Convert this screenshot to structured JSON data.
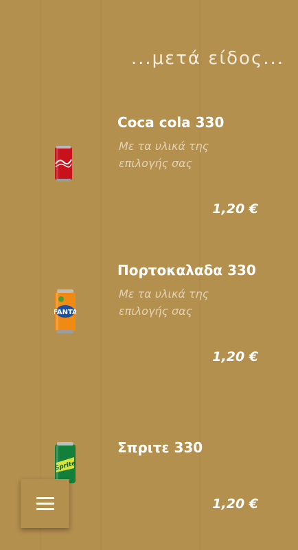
{
  "page": {
    "title": "...μετά είδος..."
  },
  "items": [
    {
      "name": "Coca cola 330",
      "description": "Με τα υλικά της επιλογής σας",
      "price": "1,20 €",
      "image": "coca-cola-can-icon",
      "can_color": "#c8111b"
    },
    {
      "name": "Πορτοκαλαδα 330",
      "description": "Με τα υλικά της επιλογής σας",
      "price": "1,20 €",
      "image": "fanta-can-icon",
      "can_color": "#f08a12"
    },
    {
      "name": "Σπριτε 330",
      "description": "",
      "price": "1,20 €",
      "image": "sprite-can-icon",
      "can_color": "#12803a"
    }
  ],
  "menu_button": {
    "icon": "hamburger-menu-icon"
  },
  "colors": {
    "background": "#b4904f",
    "title": "#f3ebdc",
    "description": "#e2d2b3",
    "text": "#ffffff"
  }
}
